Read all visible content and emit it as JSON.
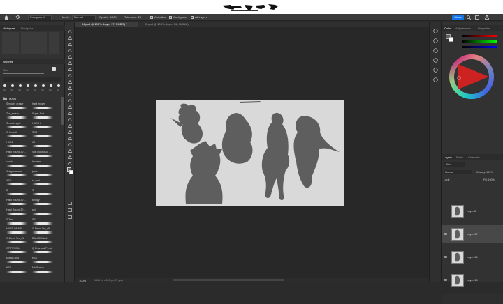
{
  "app": {
    "logo_text": "",
    "share_label": "Share"
  },
  "options_bar": {
    "preset": "Foreground",
    "mode_label": "Mode:",
    "mode_value": "Normal",
    "opacity": "Opacity: 100%",
    "tolerance": "Tolerance: 25",
    "anti_alias": "Anti-alias",
    "contiguous": "Contiguous",
    "all_layers": "All Layers"
  },
  "tabs": {
    "histogram": "Histogram",
    "navigator": "Navigator",
    "brushes": "Brushes",
    "color": "Color",
    "adjustments": "Adjustments",
    "properties": "Properties",
    "layers": "Layers",
    "paths": "Paths",
    "channels": "Channels"
  },
  "documents": [
    {
      "label": "04.psd @ 100% (Layer 17, RGB/8) *",
      "active": true
    },
    {
      "label": "05.psd @ 100% (Layer K8, RGB/8)",
      "active": false
    }
  ],
  "brushes": {
    "size_label": "Size",
    "size_values": [
      "40",
      "25",
      "30",
      "10",
      "30",
      "30",
      "50",
      "30"
    ],
    "folder": "MAIN",
    "rows": [
      [
        "Smooth_eraser",
        "hard eraser"
      ],
      [
        "Tex_eraser",
        "Super Soft"
      ],
      [
        "Smooth style",
        "HARD b"
      ],
      [
        "G Smooth",
        "SSS"
      ],
      [
        "HARD",
        "03"
      ],
      [
        "Hard Round 30 ...",
        "Soft Round 30 ..."
      ],
      [
        "comic",
        "blobsss"
      ],
      [
        "Aubgesmmen...",
        "jacie"
      ],
      [
        "ASD",
        "sk pad"
      ],
      [
        "B",
        "S"
      ],
      [
        "Hard Round 30 ...",
        "smugy"
      ],
      [
        "Hard Round 30 ...",
        "skt"
      ],
      [
        "S Tent",
        "SS"
      ],
      [
        "HARD DRAW",
        "G.Blend Tex_05"
      ],
      [
        "G.Blend Tex_05",
        "DAN SIGNAL"
      ],
      [
        "OP PENCIL",
        "Q Charcoal Pencil"
      ],
      [
        "sketch-kind",
        "KSS"
      ],
      [
        "KSS",
        "Mh Sketch"
      ]
    ]
  },
  "layers_panel": {
    "kind": "Kind",
    "blend_mode": "Normal",
    "opacity": "Opacity: 100%",
    "lock_label": "Lock:",
    "fill": "Fill: 100%",
    "layers": [
      {
        "name": "Layer 8",
        "visible": false
      },
      {
        "name": "Layer 17",
        "visible": true
      },
      {
        "name": "Layer 16",
        "visible": true
      },
      {
        "name": "Layer 15",
        "visible": true
      }
    ]
  },
  "status": {
    "zoom": "100%",
    "dimensions": "1440 px x 810 px (72 ppi)"
  },
  "colors": {
    "foreground": "#5e5e5e",
    "background": "#ffffff",
    "accent": "#1473e6"
  }
}
